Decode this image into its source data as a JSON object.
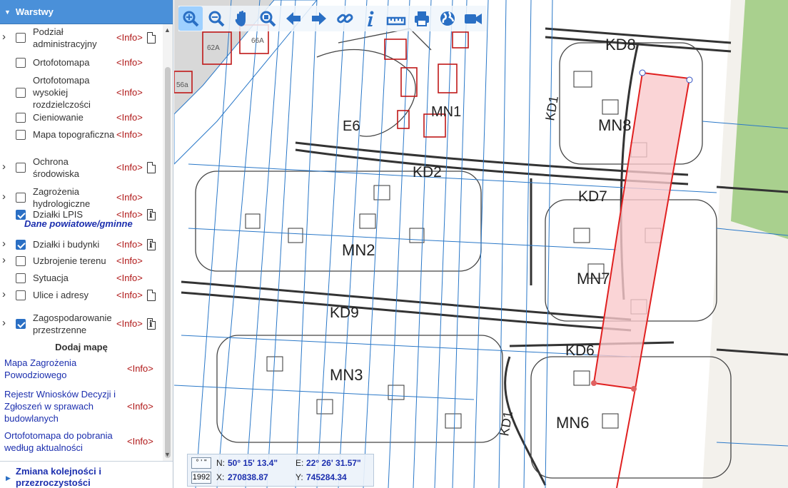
{
  "sidebar": {
    "header": "Warstwy",
    "layers": [
      {
        "label": "Podział administracyjny",
        "info": "<Info>",
        "expand": true,
        "checked": false,
        "doc": "plain"
      },
      {
        "label": "Ortofotomapa",
        "info": "<Info>",
        "expand": false,
        "checked": false,
        "doc": ""
      },
      {
        "label": "Ortofotomapa wysokiej rozdzielczości",
        "info": "<Info>",
        "expand": false,
        "checked": false,
        "doc": ""
      },
      {
        "label": "Cieniowanie",
        "info": "<Info>",
        "expand": false,
        "checked": false,
        "doc": ""
      },
      {
        "label": "Mapa topograficzna",
        "info": "<Info>",
        "expand": false,
        "checked": false,
        "doc": ""
      },
      {
        "label": "Ochrona środowiska",
        "info": "<Info>",
        "expand": true,
        "checked": false,
        "doc": "plain"
      },
      {
        "label": "Zagrożenia hydrologiczne",
        "info": "<Info>",
        "expand": true,
        "checked": false,
        "doc": ""
      },
      {
        "label": "Działki LPIS",
        "info": "<Info>",
        "expand": false,
        "checked": true,
        "doc": "info"
      },
      {
        "label": "Działki i budynki",
        "info": "<Info>",
        "expand": true,
        "checked": true,
        "doc": "info"
      },
      {
        "label": "Uzbrojenie terenu",
        "info": "<Info>",
        "expand": true,
        "checked": false,
        "doc": ""
      },
      {
        "label": "Sytuacja",
        "info": "<Info>",
        "expand": false,
        "checked": false,
        "doc": ""
      },
      {
        "label": "Ulice i adresy",
        "info": "<Info>",
        "expand": true,
        "checked": false,
        "doc": "plain"
      },
      {
        "label": "Zagospodarowanie przestrzenne",
        "info": "<Info>",
        "expand": true,
        "checked": true,
        "doc": "info"
      }
    ],
    "group_label": "Dane powiatowe/gminne",
    "add_map_title": "Dodaj mapę",
    "add_maps": [
      {
        "label": "Mapa Zagrożenia Powodziowego",
        "info": "<Info>"
      },
      {
        "label": "Rejestr Wniosków Decyzji i Zgłoszeń w sprawach budowlanych",
        "info": "<Info>"
      },
      {
        "label": "Ortofotomapa do pobrania według aktualności",
        "info": "<Info>"
      }
    ],
    "order_label": "Zmiana kolejności i przezroczystości"
  },
  "toolbar": {
    "tools": [
      "zoom-in-icon",
      "zoom-out-icon",
      "pan-hand-icon",
      "zoom-extent-icon",
      "back-arrow-icon",
      "forward-arrow-icon",
      "link-icon",
      "info-icon",
      "measure-ruler-icon",
      "print-icon",
      "globe-icon",
      "video-icon"
    ]
  },
  "map": {
    "labels": [
      "KD8",
      "MN8",
      "KD1",
      "MN1",
      "E6",
      "KD2",
      "KD7",
      "MN2",
      "MN7",
      "KD9",
      "KD6",
      "MN3",
      "MN6",
      "KD1",
      "62A",
      "66A",
      "56a"
    ]
  },
  "coords": {
    "dms_button": "° ' \"",
    "crs": "1992",
    "n_label": "N:",
    "n_value": "50° 15' 13.4\"",
    "e_label": "E:",
    "e_value": "22° 26' 31.57\"",
    "x_label": "X:",
    "x_value": "270838.87",
    "y_label": "Y:",
    "y_value": "745284.34"
  },
  "colors": {
    "header_bg": "#4a90d9",
    "link": "#1c2fae",
    "info": "#b01818",
    "parcel_fill": "#f9c9cc",
    "parcel_stroke": "#e02020",
    "grid_blue": "#2a78c8"
  }
}
